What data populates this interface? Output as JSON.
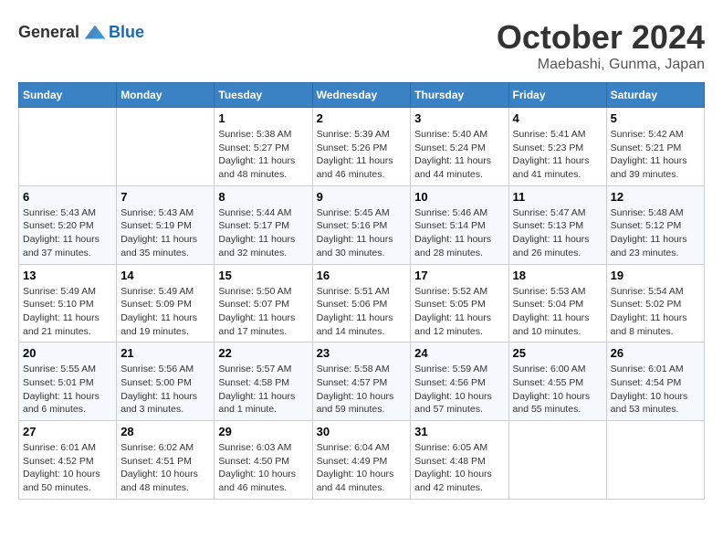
{
  "header": {
    "logo_general": "General",
    "logo_blue": "Blue",
    "month": "October 2024",
    "location": "Maebashi, Gunma, Japan"
  },
  "days_of_week": [
    "Sunday",
    "Monday",
    "Tuesday",
    "Wednesday",
    "Thursday",
    "Friday",
    "Saturday"
  ],
  "weeks": [
    [
      null,
      null,
      {
        "day": 1,
        "sunrise": "5:38 AM",
        "sunset": "5:27 PM",
        "daylight": "11 hours and 48 minutes."
      },
      {
        "day": 2,
        "sunrise": "5:39 AM",
        "sunset": "5:26 PM",
        "daylight": "11 hours and 46 minutes."
      },
      {
        "day": 3,
        "sunrise": "5:40 AM",
        "sunset": "5:24 PM",
        "daylight": "11 hours and 44 minutes."
      },
      {
        "day": 4,
        "sunrise": "5:41 AM",
        "sunset": "5:23 PM",
        "daylight": "11 hours and 41 minutes."
      },
      {
        "day": 5,
        "sunrise": "5:42 AM",
        "sunset": "5:21 PM",
        "daylight": "11 hours and 39 minutes."
      }
    ],
    [
      {
        "day": 6,
        "sunrise": "5:43 AM",
        "sunset": "5:20 PM",
        "daylight": "11 hours and 37 minutes."
      },
      {
        "day": 7,
        "sunrise": "5:43 AM",
        "sunset": "5:19 PM",
        "daylight": "11 hours and 35 minutes."
      },
      {
        "day": 8,
        "sunrise": "5:44 AM",
        "sunset": "5:17 PM",
        "daylight": "11 hours and 32 minutes."
      },
      {
        "day": 9,
        "sunrise": "5:45 AM",
        "sunset": "5:16 PM",
        "daylight": "11 hours and 30 minutes."
      },
      {
        "day": 10,
        "sunrise": "5:46 AM",
        "sunset": "5:14 PM",
        "daylight": "11 hours and 28 minutes."
      },
      {
        "day": 11,
        "sunrise": "5:47 AM",
        "sunset": "5:13 PM",
        "daylight": "11 hours and 26 minutes."
      },
      {
        "day": 12,
        "sunrise": "5:48 AM",
        "sunset": "5:12 PM",
        "daylight": "11 hours and 23 minutes."
      }
    ],
    [
      {
        "day": 13,
        "sunrise": "5:49 AM",
        "sunset": "5:10 PM",
        "daylight": "11 hours and 21 minutes."
      },
      {
        "day": 14,
        "sunrise": "5:49 AM",
        "sunset": "5:09 PM",
        "daylight": "11 hours and 19 minutes."
      },
      {
        "day": 15,
        "sunrise": "5:50 AM",
        "sunset": "5:07 PM",
        "daylight": "11 hours and 17 minutes."
      },
      {
        "day": 16,
        "sunrise": "5:51 AM",
        "sunset": "5:06 PM",
        "daylight": "11 hours and 14 minutes."
      },
      {
        "day": 17,
        "sunrise": "5:52 AM",
        "sunset": "5:05 PM",
        "daylight": "11 hours and 12 minutes."
      },
      {
        "day": 18,
        "sunrise": "5:53 AM",
        "sunset": "5:04 PM",
        "daylight": "11 hours and 10 minutes."
      },
      {
        "day": 19,
        "sunrise": "5:54 AM",
        "sunset": "5:02 PM",
        "daylight": "11 hours and 8 minutes."
      }
    ],
    [
      {
        "day": 20,
        "sunrise": "5:55 AM",
        "sunset": "5:01 PM",
        "daylight": "11 hours and 6 minutes."
      },
      {
        "day": 21,
        "sunrise": "5:56 AM",
        "sunset": "5:00 PM",
        "daylight": "11 hours and 3 minutes."
      },
      {
        "day": 22,
        "sunrise": "5:57 AM",
        "sunset": "4:58 PM",
        "daylight": "11 hours and 1 minute."
      },
      {
        "day": 23,
        "sunrise": "5:58 AM",
        "sunset": "4:57 PM",
        "daylight": "10 hours and 59 minutes."
      },
      {
        "day": 24,
        "sunrise": "5:59 AM",
        "sunset": "4:56 PM",
        "daylight": "10 hours and 57 minutes."
      },
      {
        "day": 25,
        "sunrise": "6:00 AM",
        "sunset": "4:55 PM",
        "daylight": "10 hours and 55 minutes."
      },
      {
        "day": 26,
        "sunrise": "6:01 AM",
        "sunset": "4:54 PM",
        "daylight": "10 hours and 53 minutes."
      }
    ],
    [
      {
        "day": 27,
        "sunrise": "6:01 AM",
        "sunset": "4:52 PM",
        "daylight": "10 hours and 50 minutes."
      },
      {
        "day": 28,
        "sunrise": "6:02 AM",
        "sunset": "4:51 PM",
        "daylight": "10 hours and 48 minutes."
      },
      {
        "day": 29,
        "sunrise": "6:03 AM",
        "sunset": "4:50 PM",
        "daylight": "10 hours and 46 minutes."
      },
      {
        "day": 30,
        "sunrise": "6:04 AM",
        "sunset": "4:49 PM",
        "daylight": "10 hours and 44 minutes."
      },
      {
        "day": 31,
        "sunrise": "6:05 AM",
        "sunset": "4:48 PM",
        "daylight": "10 hours and 42 minutes."
      },
      null,
      null
    ]
  ]
}
